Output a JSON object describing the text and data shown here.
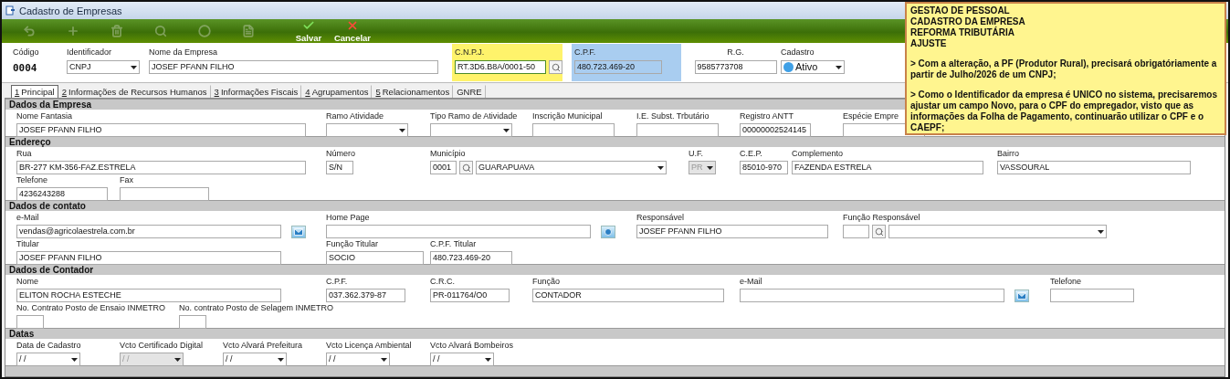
{
  "window": {
    "title": "Cadastro de Empresas"
  },
  "toolbar": [
    {
      "kind": "back",
      "disabled": true
    },
    {
      "kind": "add",
      "disabled": true
    },
    {
      "kind": "delete",
      "disabled": true
    },
    {
      "kind": "search",
      "disabled": true
    },
    {
      "kind": "suspend",
      "disabled": true
    },
    {
      "kind": "print",
      "disabled": true
    },
    {
      "kind": "save",
      "label": "Salvar",
      "disabled": false
    },
    {
      "kind": "cancel",
      "label": "Cancelar",
      "disabled": false
    }
  ],
  "header": [
    {
      "kind": "code",
      "label": "Código",
      "value": "0004"
    },
    {
      "kind": "select",
      "label": "Identificador",
      "value": "CNPJ",
      "disabled": false
    },
    {
      "kind": "text",
      "label": "Nome da Empresa",
      "value": "JOSEF PFANN FILHO"
    },
    {
      "kind": "search",
      "label": "C.N.P.J.",
      "value": "RT.3D6.B8A/0001-50",
      "color": "#fff36b"
    },
    {
      "kind": "text",
      "label": "C.P.F.",
      "value": "480.723.469-20",
      "color": "#a9cdf0"
    },
    {
      "kind": "text",
      "label": "R.G.",
      "value": "9585773708"
    },
    {
      "kind": "status",
      "label": "Cadastro",
      "value": "Ativo",
      "color": "#3fa0e6"
    }
  ],
  "tabs": [
    {
      "key": "1",
      "label": "Principal",
      "selected": true
    },
    {
      "key": "2",
      "label": "Informações de Recursos Humanos",
      "selected": false
    },
    {
      "key": "3",
      "label": "Informações Fiscais",
      "selected": false
    },
    {
      "key": "4",
      "label": "Agrupamentos",
      "selected": false
    },
    {
      "key": "5",
      "label": "Relacionamentos",
      "selected": false
    },
    {
      "label": "GNRE",
      "selected": false
    }
  ],
  "sections": [
    {
      "title": "Dados da Empresa",
      "lines": [
        {
          "fields": [
            {
              "kind": "text",
              "label": "Nome Fantasia",
              "value": "JOSEF PFANN FILHO"
            },
            {
              "kind": "select",
              "label": "Ramo Atividade",
              "disabled": false
            },
            {
              "kind": "select",
              "label": "Tipo Ramo de Atividade",
              "disabled": false
            },
            {
              "kind": "text",
              "label": "Inscrição Municipal"
            },
            {
              "kind": "text",
              "label": "I.E. Subst. Trbutário"
            },
            {
              "kind": "text",
              "label": "Registro ANTT",
              "value": "00000002524145"
            },
            {
              "kind": "text",
              "label": "Espécie Empre"
            }
          ]
        }
      ]
    },
    {
      "title": "Endereço",
      "lines": [
        {
          "fields": [
            {
              "kind": "text",
              "label": "Rua",
              "value": "BR-277 KM-356-FAZ.ESTRELA"
            },
            {
              "kind": "text",
              "label": "Número",
              "value": "S/N"
            },
            {
              "kind": "lookup",
              "label": "Município",
              "code": "0001",
              "value": "GUARAPUAVA"
            },
            {
              "kind": "select",
              "label": "U.F.",
              "value": "PR",
              "disabled": true
            },
            {
              "kind": "text",
              "label": "C.E.P.",
              "value": "85010-970"
            },
            {
              "kind": "text",
              "label": "Complemento",
              "value": "FAZENDA ESTRELA"
            },
            {
              "kind": "text",
              "label": "Bairro",
              "value": "VASSOURAL"
            }
          ]
        },
        {
          "fields": [
            {
              "kind": "text",
              "label": "Telefone",
              "value": "4236243288"
            },
            {
              "kind": "text",
              "label": "Fax"
            }
          ]
        }
      ]
    },
    {
      "title": "Dados de contato",
      "lines": [
        {
          "fields": [
            {
              "kind": "email",
              "label": "e-Mail",
              "value": "vendas@agricolaestrela.com.br"
            },
            {
              "kind": "url",
              "label": "Home Page"
            },
            {
              "kind": "text",
              "label": "Responsável",
              "value": "JOSEF PFANN FILHO"
            },
            {
              "kind": "lookup",
              "label": "Função Responsável"
            }
          ]
        },
        {
          "fields": [
            {
              "kind": "text",
              "label": "Titular",
              "value": "JOSEF PFANN FILHO"
            },
            {
              "kind": "text",
              "label": "Função Titular",
              "value": "SOCIO"
            },
            {
              "kind": "text",
              "label": "C.P.F. Titular",
              "value": "480.723.469-20"
            }
          ]
        }
      ]
    },
    {
      "title": "Dados de Contador",
      "lines": [
        {
          "fields": [
            {
              "kind": "text",
              "label": "Nome",
              "value": "ELITON ROCHA ESTECHE"
            },
            {
              "kind": "text",
              "label": "C.P.F.",
              "value": "037.362.379-87"
            },
            {
              "kind": "text",
              "label": "C.R.C.",
              "value": "PR-011764/O0"
            },
            {
              "kind": "text",
              "label": "Função",
              "value": "CONTADOR"
            },
            {
              "kind": "email",
              "label": "e-Mail"
            },
            {
              "kind": "text",
              "label": "Telefone"
            }
          ]
        },
        {
          "fields": [
            {
              "kind": "text",
              "label": "No. Contrato Posto de Ensaio INMETRO"
            },
            {
              "kind": "text",
              "label": "No. contrato Posto de Selagem INMETRO"
            }
          ]
        }
      ]
    },
    {
      "title": "Datas",
      "lines": [
        {
          "fields": [
            {
              "kind": "date",
              "label": "Data de Cadastro",
              "value": "/ /",
              "disabled": false
            },
            {
              "kind": "date",
              "label": "Vcto Certificado Digital",
              "value": "/ /",
              "disabled": true
            },
            {
              "kind": "date",
              "label": "Vcto Alvará Prefeitura",
              "value": "/ /",
              "disabled": false
            },
            {
              "kind": "date",
              "label": "Vcto Licença Ambiental",
              "value": "/ /",
              "disabled": false
            },
            {
              "kind": "date",
              "label": "Vcto Alvará Bombeiros",
              "value": "/ /",
              "disabled": false
            }
          ]
        }
      ]
    }
  ],
  "note": {
    "headings": [
      "GESTAO DE PESSOAL",
      "CADASTRO DA EMPRESA",
      "REFORMA TRIBUTÁRIA",
      "AJUSTE"
    ],
    "paragraphs": [
      "> Com a alteração, a PF (Produtor Rural), precisará obrigatóriamente a partir de Julho/2026 de um CNPJ;",
      "> Como o Identificador da empresa é UNICO no sistema, precisaremos ajustar um campo Novo, para o CPF do empregador, visto que as informações da Folha de Pagamento, continuarão utilizar o CPF e o CAEPF;"
    ]
  }
}
